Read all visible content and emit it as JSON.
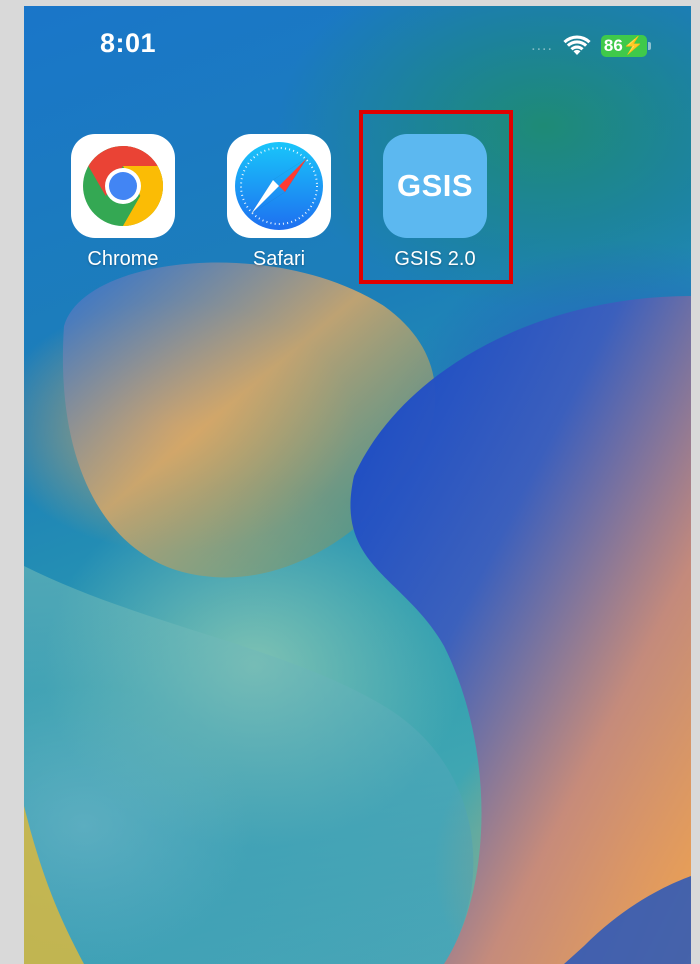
{
  "status_bar": {
    "time": "8:01",
    "signal": "....",
    "battery_level": "86",
    "battery_charging": true,
    "battery_color": "#3fc94a"
  },
  "apps": [
    {
      "label": "Chrome",
      "icon": "chrome-icon"
    },
    {
      "label": "Safari",
      "icon": "safari-compass-icon"
    },
    {
      "label": "GSIS 2.0",
      "icon_text": "GSIS",
      "icon_color": "#5cb8f0",
      "highlighted": true
    }
  ],
  "highlight_color": "#e00000"
}
